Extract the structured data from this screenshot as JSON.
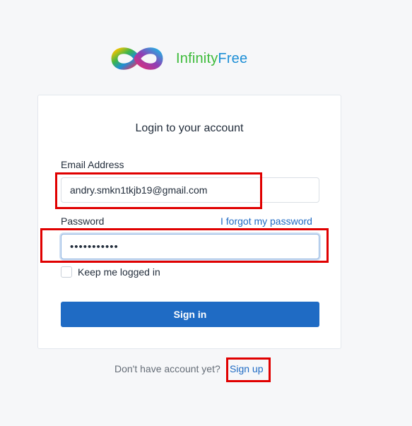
{
  "logo": {
    "icon": "infinity-logo-icon",
    "word1": "Infinity",
    "word2": "Free"
  },
  "login": {
    "title": "Login to your account",
    "email_label": "Email Address",
    "email_value": "andry.smkn1tkjb19@gmail.com",
    "password_label": "Password",
    "forgot_link": "I forgot my password",
    "password_value": "•••••••••••",
    "remember_label": "Keep me logged in",
    "remember_checked": false,
    "signin_button": "Sign in"
  },
  "footer": {
    "text": "Don't have account yet?",
    "signup_link": "Sign up"
  },
  "colors": {
    "accent": "#206bc4",
    "highlight": "#e00000",
    "logo_green": "#3dbb3a",
    "logo_blue": "#1e8fd6"
  }
}
